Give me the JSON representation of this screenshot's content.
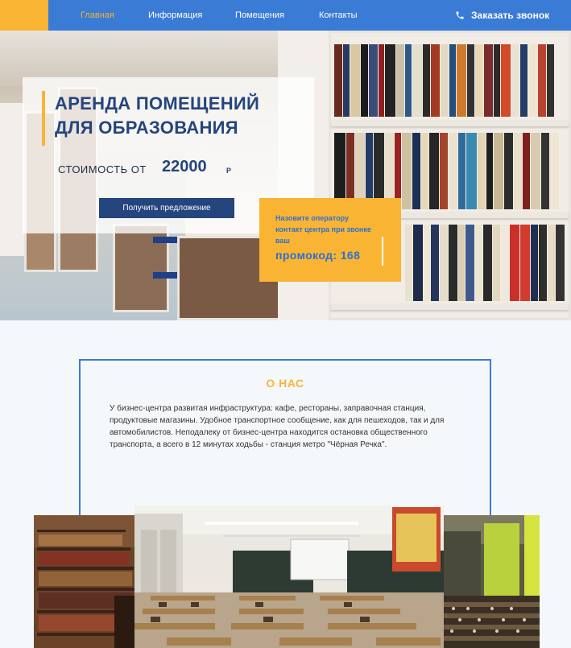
{
  "nav": {
    "items": [
      {
        "label": "Главная",
        "active": true
      },
      {
        "label": "Информация",
        "active": false
      },
      {
        "label": "Помещения",
        "active": false
      },
      {
        "label": "Контакты",
        "active": false
      }
    ],
    "phone_label": "Заказать звонок",
    "phone_icon": "phone-icon"
  },
  "hero": {
    "title": "АРЕНДА ПОМЕЩЕНИЙ ДЛЯ ОБРАЗОВАНИЯ",
    "price_label": "СТОИМОСТЬ ОТ",
    "price_value": "22000",
    "price_unit": "Р",
    "cta_label": "Получить предложение"
  },
  "promo": {
    "text": "Назовите оператору контакт центра при звонке ваш",
    "code": "промокод: 168"
  },
  "about": {
    "title": "О НАС",
    "text": "У бизнес-центра развитая инфраструктура: кафе, рестораны, заправочная станция, продуктовые магазины. Удобное транспортное сообщение, как для пешеходов, так и для автомобилистов. Неподалеку от бизнес-центра находится остановка общественного транспорта, а всего в 12 минутах ходьбы - станция метро \"Чёрная Речка\"."
  },
  "colors": {
    "nav_blue": "#3a7bd5",
    "accent_yellow": "#f9b434",
    "dark_blue": "#24457e"
  }
}
